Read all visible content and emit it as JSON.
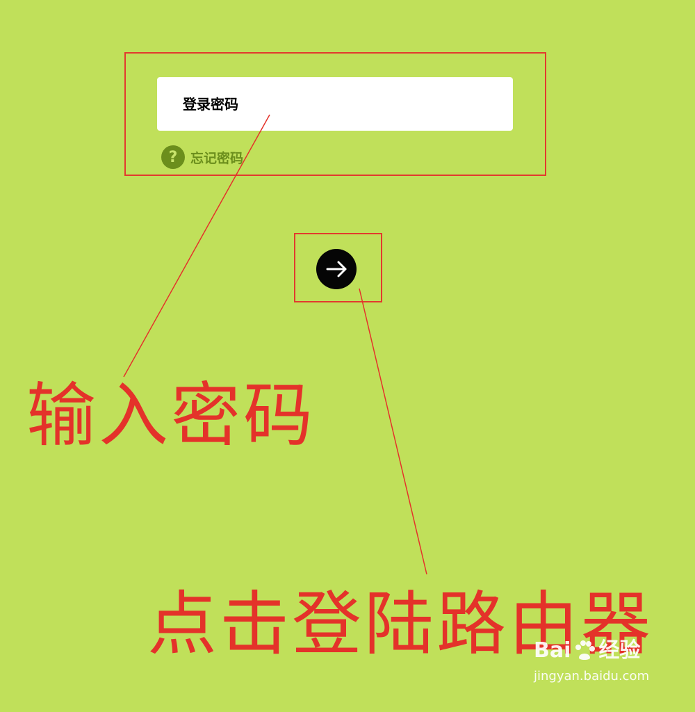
{
  "password": {
    "placeholder": "登录密码",
    "value": ""
  },
  "forgot": {
    "label": "忘记密码",
    "icon": "question-circle-icon"
  },
  "login_button": {
    "icon": "arrow-right-icon"
  },
  "annotations": {
    "enter_password": "输入密码",
    "click_login": "点击登陆路由器"
  },
  "watermark": {
    "brand_left": "Bai",
    "brand_right": "经验",
    "site": "jingyan.baidu.com"
  },
  "colors": {
    "background": "#c0e05a",
    "annotation_red": "#e4322a",
    "forgot_green": "#6b8e1c",
    "button_black": "#050505"
  }
}
